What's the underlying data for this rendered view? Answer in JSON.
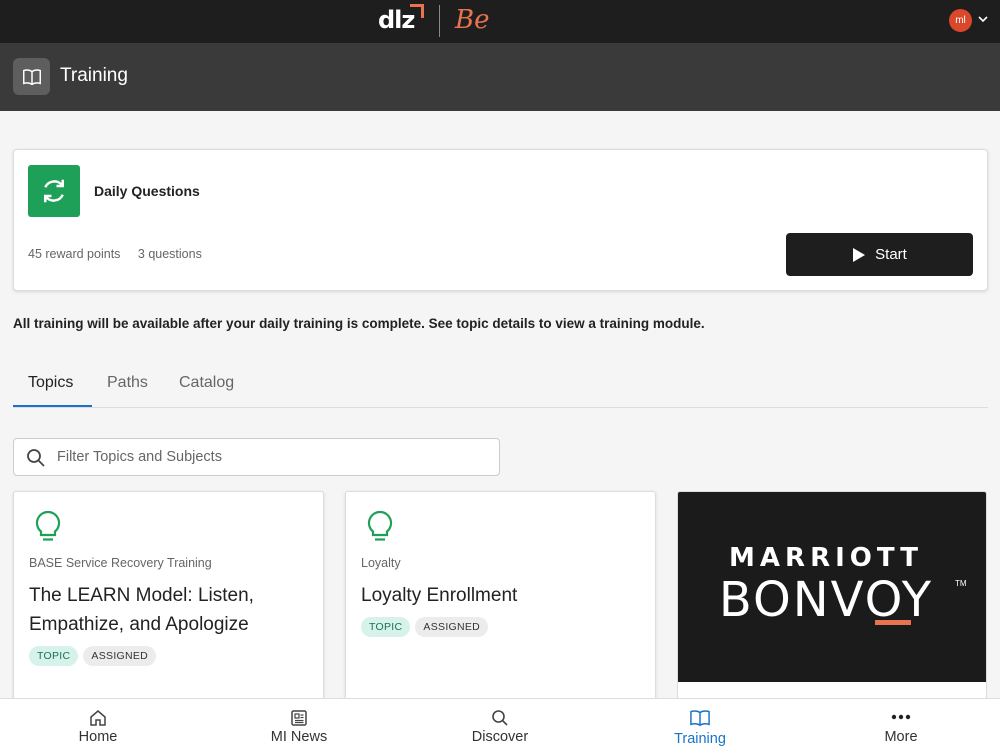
{
  "header": {
    "logo_text": "dlz",
    "logo_secondary": "Be",
    "avatar_initials": "ml"
  },
  "titlebar": {
    "title": "Training",
    "icon": "book-icon"
  },
  "daily_card": {
    "title": "Daily Questions",
    "icon": "refresh-icon",
    "reward_points": "45 reward points",
    "questions": "3 questions",
    "start_label": "Start"
  },
  "notice": "All training will be available after your daily training is complete. See topic details to view a training module.",
  "tabs": [
    {
      "label": "Topics",
      "active": true
    },
    {
      "label": "Paths",
      "active": false
    },
    {
      "label": "Catalog",
      "active": false
    }
  ],
  "search": {
    "placeholder": "Filter Topics and Subjects",
    "value": ""
  },
  "cards": [
    {
      "category": "BASE Service Recovery Training",
      "title": "The LEARN Model: Listen, Empathize, and Apologize",
      "badges": [
        "TOPIC",
        "ASSIGNED"
      ]
    },
    {
      "category": "Loyalty",
      "title": "Loyalty Enrollment",
      "badges": [
        "TOPIC",
        "ASSIGNED"
      ]
    }
  ],
  "image_card": {
    "brand_line1": "MARRIOTT",
    "brand_line2": "BONVOY",
    "trademark": "TM"
  },
  "bottom_nav": [
    {
      "label": "Home",
      "icon": "home-icon",
      "active": false
    },
    {
      "label": "MI News",
      "icon": "newspaper-icon",
      "active": false
    },
    {
      "label": "Discover",
      "icon": "search-icon",
      "active": false
    },
    {
      "label": "Training",
      "icon": "book-icon",
      "active": true
    },
    {
      "label": "More",
      "icon": "more-dots-icon",
      "active": false
    }
  ],
  "colors": {
    "accent": "#1a73c8",
    "brand_orange": "#e8734f",
    "daily_green": "#1fa058",
    "topic_badge": "#d7f2ea"
  }
}
